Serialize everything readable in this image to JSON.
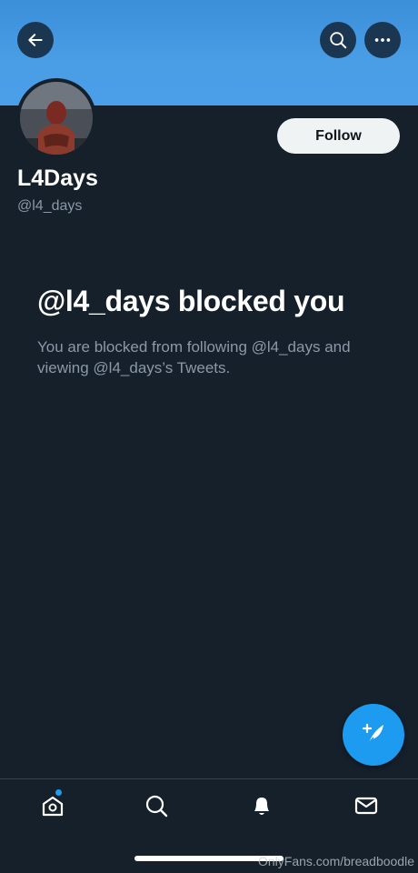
{
  "header": {
    "back_icon": "arrow-left-icon",
    "search_icon": "search-icon",
    "more_icon": "more-horizontal-icon",
    "banner_color": "#4a9ee6"
  },
  "profile": {
    "display_name": "L4Days",
    "handle": "@l4_days",
    "follow_label": "Follow",
    "avatar_icon": "avatar"
  },
  "blocked": {
    "title": "@l4_days blocked you",
    "description": "You are blocked from following @l4_days and viewing @l4_days’s Tweets."
  },
  "fab": {
    "icon": "compose-tweet-icon",
    "color": "#1d9bf0"
  },
  "bottom_nav": {
    "items": [
      {
        "name": "home",
        "icon": "home-icon",
        "has_notification_dot": true
      },
      {
        "name": "search",
        "icon": "search-icon"
      },
      {
        "name": "notifications",
        "icon": "bell-icon"
      },
      {
        "name": "messages",
        "icon": "mail-icon"
      }
    ]
  },
  "watermark": "OnlyFans.com/breadboodle"
}
